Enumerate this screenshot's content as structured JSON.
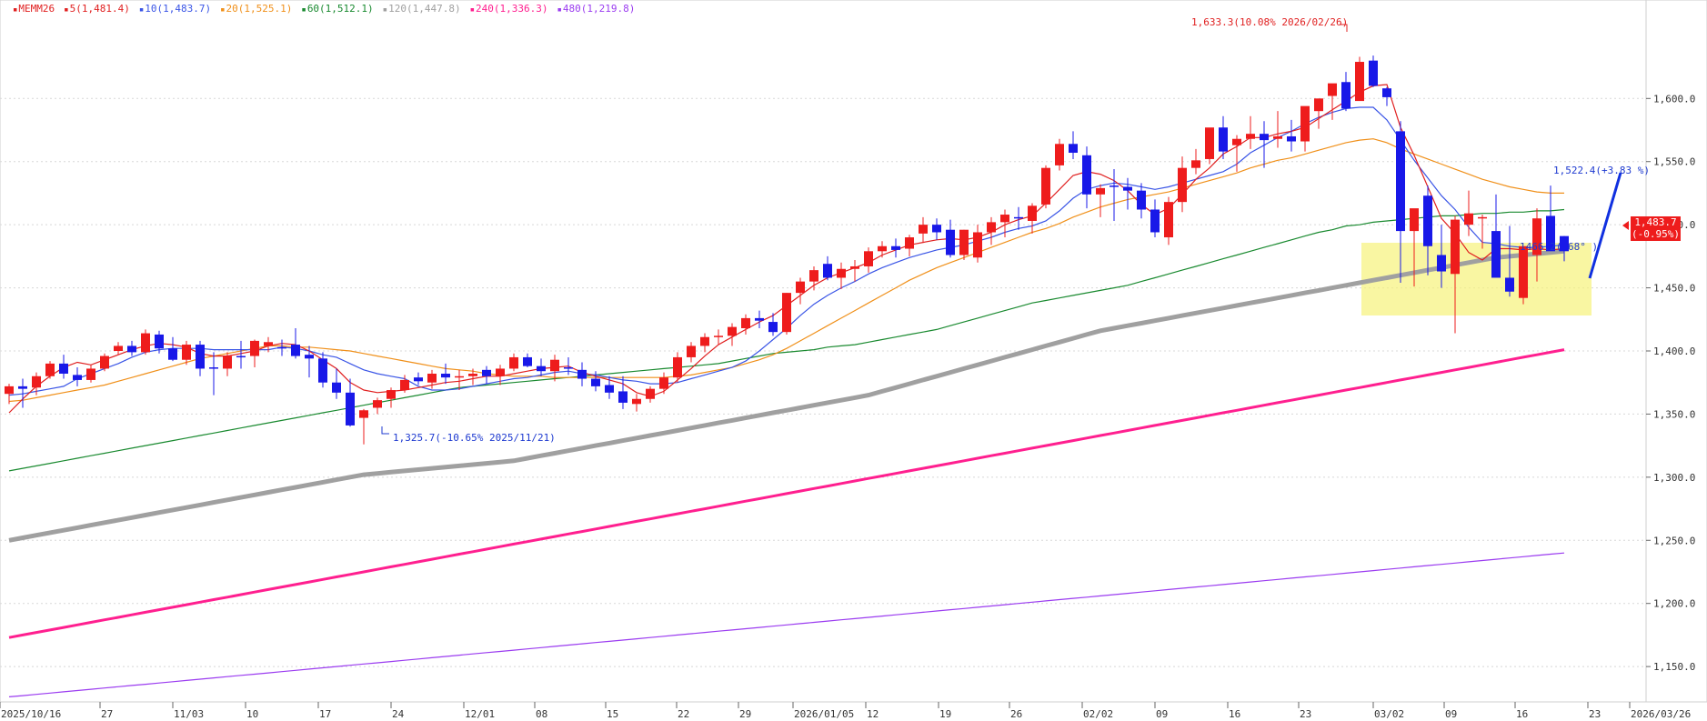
{
  "instrument": "MEMM26",
  "legend": [
    {
      "label": "MEMM26",
      "color": "#e02020",
      "marker": "▪"
    },
    {
      "label": "5(1,481.4)",
      "color": "#e02020",
      "marker": "▪"
    },
    {
      "label": "10(1,483.7)",
      "color": "#3a55e6",
      "marker": "▪"
    },
    {
      "label": "20(1,525.1)",
      "color": "#f0901a",
      "marker": "▪"
    },
    {
      "label": "60(1,512.1)",
      "color": "#1a8a30",
      "marker": "▪"
    },
    {
      "label": "120(1,447.8)",
      "color": "#a0a0a0",
      "marker": "▪"
    },
    {
      "label": "240(1,336.3)",
      "color": "#ff1f8f",
      "marker": "▪"
    },
    {
      "label": "480(1,219.8)",
      "color": "#9b3cf0",
      "marker": "▪"
    }
  ],
  "annotations": {
    "high": "1,633.3(10.08% 2026/02/26)",
    "low": "1,325.7(-10.65% 2025/11/21)",
    "target": "1,522.4(+3.83 %)",
    "angle": "1466.2( 68° )"
  },
  "price_box": {
    "value": "1,483.7",
    "change": "(-0.95%)"
  },
  "chart_data": {
    "type": "candlestick",
    "y_ticks": [
      "1,600.0",
      "1,550.0",
      "1,500.0",
      "1,450.0",
      "1,400.0",
      "1,350.0",
      "1,300.0",
      "1,250.0",
      "1,200.0",
      "1,150.0"
    ],
    "y_tick_values": [
      1600,
      1550,
      1500,
      1450,
      1400,
      1350,
      1300,
      1250,
      1200,
      1150
    ],
    "ylim": [
      1122,
      1678
    ],
    "x_ticks": [
      "2025/10/16",
      "27",
      "11/03",
      "10",
      "17",
      "24",
      "12/01",
      "08",
      "15",
      "22",
      "29",
      "2026/01/05",
      "12",
      "19",
      "26",
      "02/02",
      "09",
      "16",
      "23",
      "03/02",
      "09",
      "16",
      "23",
      "2026/03/26"
    ],
    "candles": [
      [
        1366,
        1374,
        1358,
        1372
      ],
      [
        1372,
        1378,
        1355,
        1370
      ],
      [
        1371,
        1383,
        1365,
        1380
      ],
      [
        1380,
        1392,
        1378,
        1390
      ],
      [
        1390,
        1397,
        1378,
        1382
      ],
      [
        1381,
        1387,
        1372,
        1377
      ],
      [
        1377,
        1389,
        1375,
        1386
      ],
      [
        1386,
        1398,
        1384,
        1396
      ],
      [
        1400,
        1407,
        1397,
        1404
      ],
      [
        1404,
        1408,
        1396,
        1399
      ],
      [
        1399,
        1417,
        1397,
        1414
      ],
      [
        1413,
        1416,
        1398,
        1402
      ],
      [
        1402,
        1411,
        1392,
        1393
      ],
      [
        1393,
        1408,
        1389,
        1405
      ],
      [
        1405,
        1408,
        1380,
        1386
      ],
      [
        1387,
        1399,
        1365,
        1386
      ],
      [
        1386,
        1399,
        1380,
        1396
      ],
      [
        1396,
        1408,
        1386,
        1395
      ],
      [
        1396,
        1409,
        1387,
        1408
      ],
      [
        1404,
        1411,
        1399,
        1407
      ],
      [
        1403,
        1409,
        1396,
        1402
      ],
      [
        1405,
        1418,
        1394,
        1396
      ],
      [
        1397,
        1404,
        1379,
        1394
      ],
      [
        1394,
        1399,
        1371,
        1375
      ],
      [
        1375,
        1386,
        1362,
        1367
      ],
      [
        1367,
        1378,
        1340,
        1341
      ],
      [
        1347,
        1354,
        1326,
        1353
      ],
      [
        1355,
        1363,
        1350,
        1361
      ],
      [
        1362,
        1371,
        1355,
        1369
      ],
      [
        1369,
        1381,
        1367,
        1377
      ],
      [
        1379,
        1383,
        1373,
        1376
      ],
      [
        1375,
        1385,
        1370,
        1382
      ],
      [
        1382,
        1390,
        1374,
        1379
      ],
      [
        1379,
        1385,
        1369,
        1380
      ],
      [
        1380,
        1386,
        1373,
        1382
      ],
      [
        1385,
        1388,
        1374,
        1380
      ],
      [
        1380,
        1389,
        1373,
        1386
      ],
      [
        1386,
        1398,
        1384,
        1395
      ],
      [
        1395,
        1398,
        1387,
        1388
      ],
      [
        1388,
        1394,
        1380,
        1384
      ],
      [
        1384,
        1397,
        1376,
        1393
      ],
      [
        1387,
        1395,
        1381,
        1386
      ],
      [
        1385,
        1391,
        1372,
        1378
      ],
      [
        1378,
        1384,
        1368,
        1372
      ],
      [
        1373,
        1380,
        1362,
        1367
      ],
      [
        1368,
        1380,
        1354,
        1359
      ],
      [
        1358,
        1366,
        1352,
        1362
      ],
      [
        1362,
        1372,
        1359,
        1370
      ],
      [
        1370,
        1383,
        1366,
        1379
      ],
      [
        1379,
        1399,
        1375,
        1395
      ],
      [
        1395,
        1407,
        1391,
        1404
      ],
      [
        1404,
        1414,
        1399,
        1411
      ],
      [
        1411,
        1417,
        1405,
        1412
      ],
      [
        1412,
        1422,
        1404,
        1419
      ],
      [
        1418,
        1429,
        1413,
        1426
      ],
      [
        1426,
        1432,
        1418,
        1424
      ],
      [
        1423,
        1430,
        1412,
        1415
      ],
      [
        1415,
        1446,
        1413,
        1446
      ],
      [
        1446,
        1458,
        1437,
        1455
      ],
      [
        1455,
        1467,
        1448,
        1464
      ],
      [
        1469,
        1475,
        1456,
        1458
      ],
      [
        1458,
        1470,
        1449,
        1465
      ],
      [
        1465,
        1472,
        1455,
        1467
      ],
      [
        1467,
        1482,
        1462,
        1479
      ],
      [
        1479,
        1487,
        1474,
        1483
      ],
      [
        1483,
        1489,
        1474,
        1480
      ],
      [
        1481,
        1492,
        1475,
        1490
      ],
      [
        1493,
        1506,
        1486,
        1500
      ],
      [
        1500,
        1505,
        1488,
        1494
      ],
      [
        1496,
        1504,
        1474,
        1476
      ],
      [
        1476,
        1496,
        1472,
        1496
      ],
      [
        1474,
        1500,
        1470,
        1494
      ],
      [
        1494,
        1506,
        1484,
        1502
      ],
      [
        1502,
        1512,
        1490,
        1508
      ],
      [
        1506,
        1514,
        1496,
        1505
      ],
      [
        1503,
        1517,
        1493,
        1515
      ],
      [
        1516,
        1547,
        1513,
        1545
      ],
      [
        1547,
        1568,
        1543,
        1564
      ],
      [
        1564,
        1574,
        1552,
        1557
      ],
      [
        1555,
        1562,
        1513,
        1524
      ],
      [
        1524,
        1532,
        1506,
        1529
      ],
      [
        1531,
        1544,
        1503,
        1530
      ],
      [
        1530,
        1537,
        1512,
        1527
      ],
      [
        1527,
        1533,
        1505,
        1512
      ],
      [
        1512,
        1520,
        1490,
        1494
      ],
      [
        1490,
        1522,
        1484,
        1518
      ],
      [
        1518,
        1554,
        1510,
        1545
      ],
      [
        1545,
        1560,
        1540,
        1551
      ],
      [
        1552,
        1576,
        1548,
        1577
      ],
      [
        1577,
        1586,
        1552,
        1558
      ],
      [
        1563,
        1571,
        1542,
        1568
      ],
      [
        1568,
        1586,
        1560,
        1572
      ],
      [
        1572,
        1582,
        1545,
        1567
      ],
      [
        1568,
        1590,
        1561,
        1570
      ],
      [
        1570,
        1583,
        1558,
        1566
      ],
      [
        1566,
        1584,
        1558,
        1594
      ],
      [
        1590,
        1598,
        1576,
        1600
      ],
      [
        1602,
        1605,
        1583,
        1612
      ],
      [
        1613,
        1621,
        1590,
        1592
      ],
      [
        1598,
        1633,
        1599,
        1629
      ],
      [
        1630,
        1634,
        1609,
        1610
      ],
      [
        1608,
        1609,
        1594,
        1601
      ],
      [
        1574,
        1582,
        1454,
        1495
      ],
      [
        1495,
        1499,
        1451,
        1513
      ],
      [
        1523,
        1531,
        1460,
        1483
      ],
      [
        1476,
        1500,
        1450,
        1463
      ],
      [
        1461,
        1507,
        1414,
        1504
      ],
      [
        1500,
        1527,
        1491,
        1509
      ],
      [
        1506,
        1508,
        1481,
        1506
      ],
      [
        1495,
        1524,
        1460,
        1458
      ],
      [
        1458,
        1499,
        1443,
        1447
      ],
      [
        1442,
        1478,
        1437,
        1483
      ],
      [
        1476,
        1513,
        1455,
        1505
      ],
      [
        1507,
        1531,
        1490,
        1479
      ],
      [
        1491,
        1491,
        1471,
        1479
      ]
    ],
    "ma5": [
      1351,
      1362,
      1372,
      1380,
      1387,
      1391,
      1389,
      1393,
      1397,
      1401,
      1404,
      1406,
      1405,
      1403,
      1398,
      1396,
      1396,
      1398,
      1400,
      1404,
      1406,
      1405,
      1400,
      1393,
      1386,
      1375,
      1369,
      1367,
      1368,
      1369,
      1371,
      1373,
      1375,
      1376,
      1378,
      1380,
      1380,
      1382,
      1384,
      1386,
      1387,
      1388,
      1383,
      1380,
      1377,
      1374,
      1367,
      1364,
      1368,
      1377,
      1386,
      1396,
      1405,
      1411,
      1417,
      1423,
      1428,
      1436,
      1444,
      1452,
      1458,
      1462,
      1466,
      1470,
      1476,
      1480,
      1484,
      1486,
      1488,
      1489,
      1488,
      1490,
      1494,
      1500,
      1504,
      1507,
      1517,
      1528,
      1539,
      1542,
      1540,
      1535,
      1527,
      1516,
      1508,
      1513,
      1524,
      1536,
      1545,
      1556,
      1562,
      1569,
      1569,
      1572,
      1574,
      1577,
      1584,
      1591,
      1598,
      1605,
      1610,
      1611,
      1577,
      1555,
      1530,
      1505,
      1493,
      1478,
      1472,
      1481,
      1481,
      1480,
      1481,
      1480,
      1481
    ],
    "ma10": [
      1365,
      1366,
      1368,
      1370,
      1372,
      1378,
      1382,
      1386,
      1390,
      1395,
      1399,
      1401,
      1402,
      1402,
      1402,
      1401,
      1401,
      1401,
      1401,
      1401,
      1403,
      1402,
      1400,
      1397,
      1395,
      1390,
      1385,
      1382,
      1380,
      1378,
      1372,
      1369,
      1369,
      1370,
      1372,
      1374,
      1376,
      1378,
      1379,
      1381,
      1383,
      1384,
      1382,
      1381,
      1379,
      1377,
      1376,
      1374,
      1374,
      1375,
      1378,
      1381,
      1384,
      1387,
      1392,
      1400,
      1409,
      1418,
      1428,
      1437,
      1444,
      1450,
      1455,
      1461,
      1466,
      1470,
      1474,
      1477,
      1480,
      1482,
      1484,
      1487,
      1490,
      1494,
      1497,
      1499,
      1503,
      1511,
      1521,
      1528,
      1531,
      1533,
      1532,
      1530,
      1528,
      1530,
      1533,
      1536,
      1539,
      1542,
      1548,
      1557,
      1563,
      1569,
      1574,
      1580,
      1585,
      1589,
      1592,
      1593,
      1593,
      1583,
      1567,
      1551,
      1537,
      1523,
      1512,
      1498,
      1486,
      1485,
      1483,
      1482,
      1482,
      1483,
      1484
    ],
    "ma20": [
      1360,
      1361,
      1363,
      1365,
      1367,
      1369,
      1371,
      1373,
      1376,
      1379,
      1382,
      1385,
      1388,
      1391,
      1394,
      1396,
      1398,
      1400,
      1402,
      1404,
      1404,
      1403,
      1403,
      1402,
      1401,
      1400,
      1398,
      1396,
      1394,
      1392,
      1390,
      1388,
      1386,
      1385,
      1384,
      1382,
      1381,
      1380,
      1380,
      1380,
      1379,
      1379,
      1379,
      1379,
      1379,
      1379,
      1379,
      1379,
      1379,
      1380,
      1381,
      1383,
      1385,
      1387,
      1390,
      1393,
      1397,
      1402,
      1408,
      1414,
      1420,
      1426,
      1432,
      1438,
      1444,
      1450,
      1456,
      1461,
      1466,
      1470,
      1474,
      1478,
      1482,
      1486,
      1490,
      1494,
      1497,
      1501,
      1506,
      1510,
      1514,
      1517,
      1520,
      1522,
      1524,
      1526,
      1529,
      1532,
      1535,
      1538,
      1541,
      1545,
      1548,
      1551,
      1553,
      1556,
      1559,
      1562,
      1565,
      1567,
      1568,
      1565,
      1560,
      1556,
      1552,
      1548,
      1544,
      1540,
      1536,
      1533,
      1530,
      1528,
      1526,
      1525,
      1525
    ],
    "ma60": [
      1305,
      1307,
      1309,
      1311,
      1313,
      1315,
      1317,
      1319,
      1321,
      1323,
      1325,
      1327,
      1329,
      1331,
      1333,
      1335,
      1337,
      1339,
      1341,
      1343,
      1345,
      1347,
      1349,
      1351,
      1353,
      1355,
      1357,
      1359,
      1361,
      1363,
      1365,
      1367,
      1369,
      1371,
      1372,
      1373,
      1374,
      1375,
      1376,
      1377,
      1378,
      1379,
      1380,
      1381,
      1382,
      1383,
      1384,
      1385,
      1386,
      1387,
      1388,
      1389,
      1390,
      1392,
      1394,
      1396,
      1398,
      1399,
      1400,
      1401,
      1403,
      1404,
      1405,
      1407,
      1409,
      1411,
      1413,
      1415,
      1417,
      1420,
      1423,
      1426,
      1429,
      1432,
      1435,
      1438,
      1440,
      1442,
      1444,
      1446,
      1448,
      1450,
      1452,
      1455,
      1458,
      1461,
      1464,
      1467,
      1470,
      1473,
      1476,
      1479,
      1482,
      1485,
      1488,
      1491,
      1494,
      1496,
      1499,
      1500,
      1502,
      1503,
      1504,
      1505,
      1506,
      1507,
      1507,
      1508,
      1509,
      1509,
      1510,
      1510,
      1511,
      1511,
      1512
    ],
    "ma120": [
      1250,
      1252,
      1254,
      1256,
      1258,
      1260,
      1262,
      1264,
      1266,
      1268,
      1270,
      1272,
      1274,
      1276,
      1278,
      1280,
      1282,
      1284,
      1286,
      1288,
      1290,
      1292,
      1294,
      1296,
      1298,
      1300,
      1302,
      1303,
      1304,
      1305,
      1306,
      1307,
      1308,
      1309,
      1310,
      1311,
      1312,
      1313,
      1315,
      1317,
      1319,
      1321,
      1323,
      1325,
      1327,
      1329,
      1331,
      1333,
      1335,
      1337,
      1339,
      1341,
      1343,
      1345,
      1347,
      1349,
      1351,
      1353,
      1355,
      1357,
      1359,
      1361,
      1363,
      1365,
      1368,
      1371,
      1374,
      1377,
      1380,
      1383,
      1386,
      1389,
      1392,
      1395,
      1398,
      1401,
      1404,
      1407,
      1410,
      1413,
      1416,
      1418,
      1420,
      1422,
      1424,
      1426,
      1428,
      1430,
      1432,
      1434,
      1436,
      1438,
      1440,
      1442,
      1444,
      1446,
      1448,
      1450,
      1452,
      1454,
      1456,
      1458,
      1460,
      1462,
      1464,
      1466,
      1468,
      1470,
      1472,
      1474,
      1475,
      1476,
      1477,
      1478,
      1479
    ],
    "ma240": [
      1173,
      1175,
      1177,
      1179,
      1181,
      1183,
      1185,
      1187,
      1189,
      1191,
      1193,
      1195,
      1197,
      1199,
      1201,
      1203,
      1205,
      1207,
      1209,
      1211,
      1213,
      1215,
      1217,
      1219,
      1221,
      1223,
      1225,
      1227,
      1229,
      1231,
      1233,
      1235,
      1237,
      1239,
      1241,
      1243,
      1245,
      1247,
      1249,
      1251,
      1253,
      1255,
      1257,
      1259,
      1261,
      1263,
      1265,
      1267,
      1269,
      1271,
      1273,
      1275,
      1277,
      1279,
      1281,
      1283,
      1285,
      1287,
      1289,
      1291,
      1293,
      1295,
      1297,
      1299,
      1301,
      1303,
      1305,
      1307,
      1309,
      1311,
      1313,
      1315,
      1317,
      1319,
      1321,
      1323,
      1325,
      1327,
      1329,
      1331,
      1333,
      1335,
      1337,
      1339,
      1341,
      1343,
      1345,
      1347,
      1349,
      1351,
      1353,
      1355,
      1357,
      1359,
      1361,
      1363,
      1365,
      1367,
      1369,
      1371,
      1373,
      1375,
      1377,
      1379,
      1381,
      1383,
      1385,
      1387,
      1389,
      1391,
      1393,
      1395,
      1397,
      1399,
      1401
    ],
    "ma480": [
      1126,
      1127,
      1128,
      1129,
      1130,
      1131,
      1132,
      1133,
      1134,
      1135,
      1136,
      1137,
      1138,
      1139,
      1140,
      1141,
      1142,
      1143,
      1144,
      1145,
      1146,
      1147,
      1148,
      1149,
      1150,
      1151,
      1152,
      1153,
      1154,
      1155,
      1156,
      1157,
      1158,
      1159,
      1160,
      1161,
      1162,
      1163,
      1164,
      1165,
      1166,
      1167,
      1168,
      1169,
      1170,
      1171,
      1172,
      1173,
      1174,
      1175,
      1176,
      1177,
      1178,
      1179,
      1180,
      1181,
      1182,
      1183,
      1184,
      1185,
      1186,
      1187,
      1188,
      1189,
      1190,
      1191,
      1192,
      1193,
      1194,
      1195,
      1196,
      1197,
      1198,
      1199,
      1200,
      1201,
      1202,
      1203,
      1204,
      1205,
      1206,
      1207,
      1208,
      1209,
      1210,
      1211,
      1212,
      1213,
      1214,
      1215,
      1216,
      1217,
      1218,
      1219,
      1220,
      1221,
      1222,
      1223,
      1224,
      1225,
      1226,
      1227,
      1228,
      1229,
      1230,
      1231,
      1232,
      1233,
      1234,
      1235,
      1236,
      1237,
      1238,
      1239,
      1240
    ]
  }
}
